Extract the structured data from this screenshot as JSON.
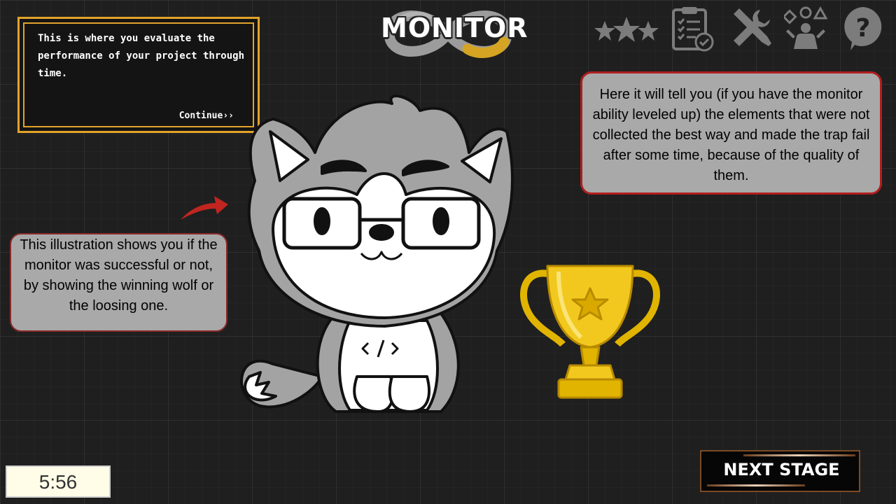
{
  "title": "MONITOR",
  "dialog": {
    "text": "This is where you evaluate the performance of your project through time.",
    "continue_label": "Continue››"
  },
  "toolbar": {
    "icons": [
      "stars-icon",
      "clipboard-check-icon",
      "tools-icon",
      "user-shapes-icon",
      "help-icon"
    ]
  },
  "callouts": {
    "right": "Here it will tell you (if you have the monitor ability leveled up) the elements that were not collected the best way and made the trap fail after some time, because of the quality of them.",
    "left": "This illustration shows you if the monitor was successful or not, by showing the winning wolf or the loosing one."
  },
  "timer": "5:56",
  "next_stage_label": "NEXT STAGE",
  "colors": {
    "background": "#1f1f1f",
    "dialog_border": "#e2a32b",
    "callout_fill": "#a9a9a9",
    "callout_border": "#b01e1e",
    "trophy_gold": "#f2c81e",
    "arrow_red": "#c0251f"
  }
}
